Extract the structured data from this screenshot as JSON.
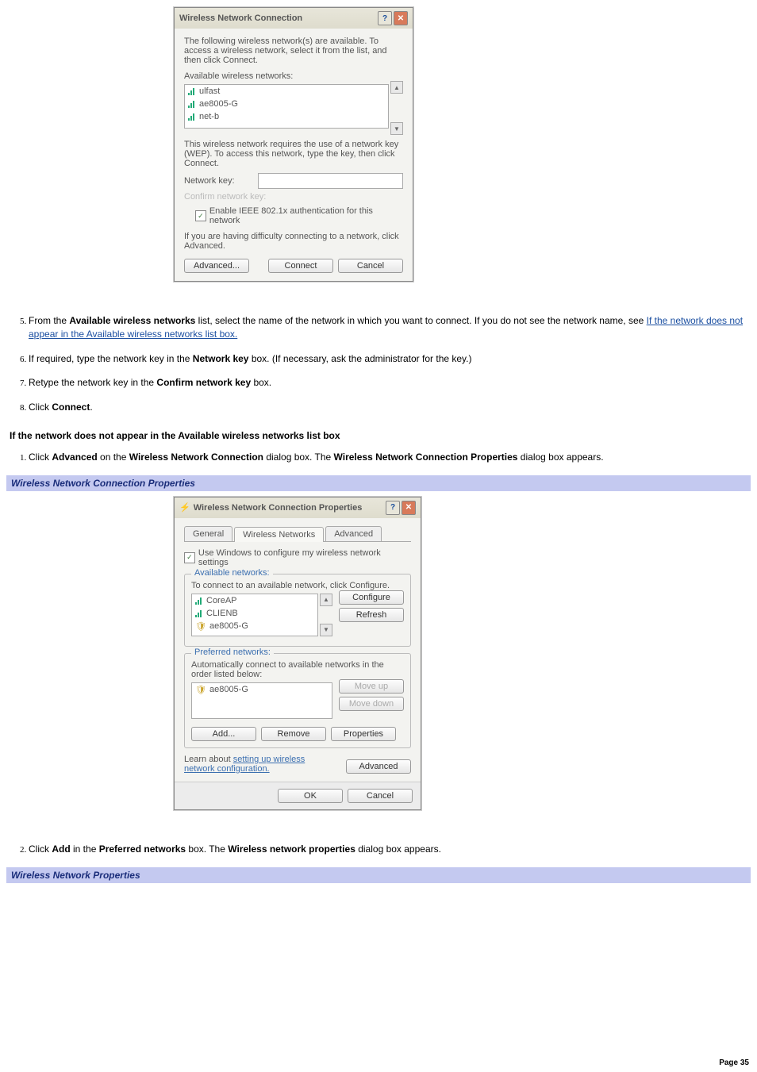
{
  "dialog1": {
    "title": "Wireless Network Connection",
    "intro": "The following wireless network(s) are available. To access a wireless network, select it from the list, and then click Connect.",
    "list_label": "Available wireless networks:",
    "networks": [
      "ulfast",
      "ae8005-G",
      "net-b"
    ],
    "wep_text": "This wireless network requires the use of a network key (WEP). To access this network, type the key, then click Connect.",
    "netkey_label": "Network key:",
    "confirm_label": "Confirm network key:",
    "ieee_checkbox": "Enable IEEE 802.1x authentication for this network",
    "difficulty": "If you are having difficulty connecting to a network, click Advanced.",
    "advanced_btn": "Advanced...",
    "connect_btn": "Connect",
    "cancel_btn": "Cancel"
  },
  "steps_a": {
    "s5_pre": "From the ",
    "s5_b1": "Available wireless networks",
    "s5_mid": " list, select the name of the network in which you want to connect. If you do not see the network name, see ",
    "s5_link": "If the network does not appear in the Available wireless networks list box.",
    "s6_pre": "If required, type the network key in the ",
    "s6_b1": "Network key",
    "s6_post": " box. (If necessary, ask the administrator for the key.)",
    "s7_pre": "Retype the network key in the ",
    "s7_b1": "Confirm network key",
    "s7_post": " box.",
    "s8_pre": "Click ",
    "s8_b1": "Connect",
    "s8_post": "."
  },
  "heading1": "If the network does not appear in the Available wireless networks list box",
  "steps_b": {
    "s1_pre": "Click ",
    "s1_b1": "Advanced",
    "s1_mid1": " on the ",
    "s1_b2": "Wireless Network Connection",
    "s1_mid2": " dialog box. The ",
    "s1_b3": "Wireless Network Connection Properties",
    "s1_post": " dialog box appears."
  },
  "bluebar1": "Wireless Network Connection Properties",
  "dialog2": {
    "title": "Wireless Network Connection Properties",
    "tabs": [
      "General",
      "Wireless Networks",
      "Advanced"
    ],
    "use_windows": "Use Windows to configure my wireless network settings",
    "avail_label": "Available networks:",
    "avail_text": "To connect to an available network, click Configure.",
    "avail_items": [
      "CoreAP",
      "CLIENB",
      "ae8005-G"
    ],
    "configure_btn": "Configure",
    "refresh_btn": "Refresh",
    "pref_label": "Preferred networks:",
    "pref_text": "Automatically connect to available networks in the order listed below:",
    "pref_items": [
      "ae8005-G"
    ],
    "moveup_btn": "Move up",
    "movedown_btn": "Move down",
    "add_btn": "Add...",
    "remove_btn": "Remove",
    "properties_btn": "Properties",
    "learn_pre": "Learn about ",
    "learn_link": "setting up wireless network configuration.",
    "advanced_btn": "Advanced",
    "ok_btn": "OK",
    "cancel_btn": "Cancel"
  },
  "steps_c": {
    "s2_pre": "Click ",
    "s2_b1": "Add",
    "s2_mid1": " in the ",
    "s2_b2": "Preferred networks",
    "s2_mid2": " box. The ",
    "s2_b3": "Wireless network properties",
    "s2_post": " dialog box appears."
  },
  "bluebar2": "Wireless Network Properties",
  "page_number": "Page 35"
}
